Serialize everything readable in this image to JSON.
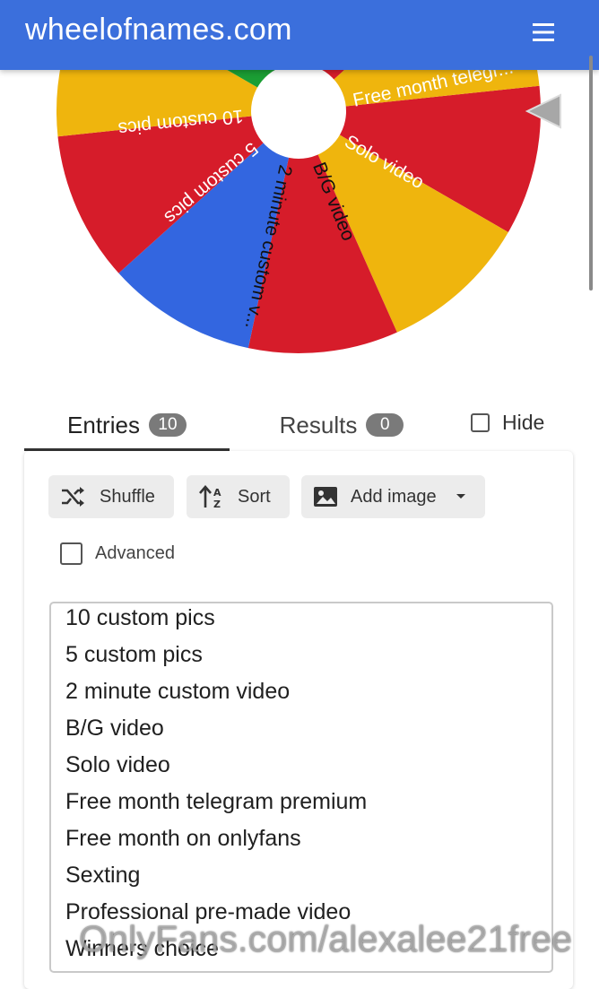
{
  "appbar": {
    "title": "wheelofnames.com"
  },
  "wheel": {
    "labels": [
      "Free month telegr...",
      "Solo video",
      "B/G video",
      "2 minute custom v...",
      "5 custom pics",
      "10 custom pics"
    ],
    "colors": {
      "red": "#d61c2a",
      "blue": "#3366e0",
      "green": "#1b9e34",
      "yellow": "#efb50d"
    }
  },
  "tabs": {
    "entries_label": "Entries",
    "entries_count": "10",
    "results_label": "Results",
    "results_count": "0",
    "hide_label": "Hide"
  },
  "toolbar": {
    "shuffle_label": "Shuffle",
    "sort_label": "Sort",
    "add_image_label": "Add image",
    "advanced_label": "Advanced"
  },
  "entries": [
    "10 custom pics",
    "5 custom pics",
    "2 minute custom video",
    "B/G video",
    "Solo video",
    "Free month telegram premium",
    "Free month on onlyfans",
    "Sexting",
    "Professional pre-made video",
    "Winners choice"
  ],
  "watermark": "OnlyFans.com/alexalee21free",
  "icons": [
    "menu-icon",
    "pointer-icon",
    "shuffle-icon",
    "sort-icon",
    "image-icon",
    "chevron-down-icon"
  ]
}
